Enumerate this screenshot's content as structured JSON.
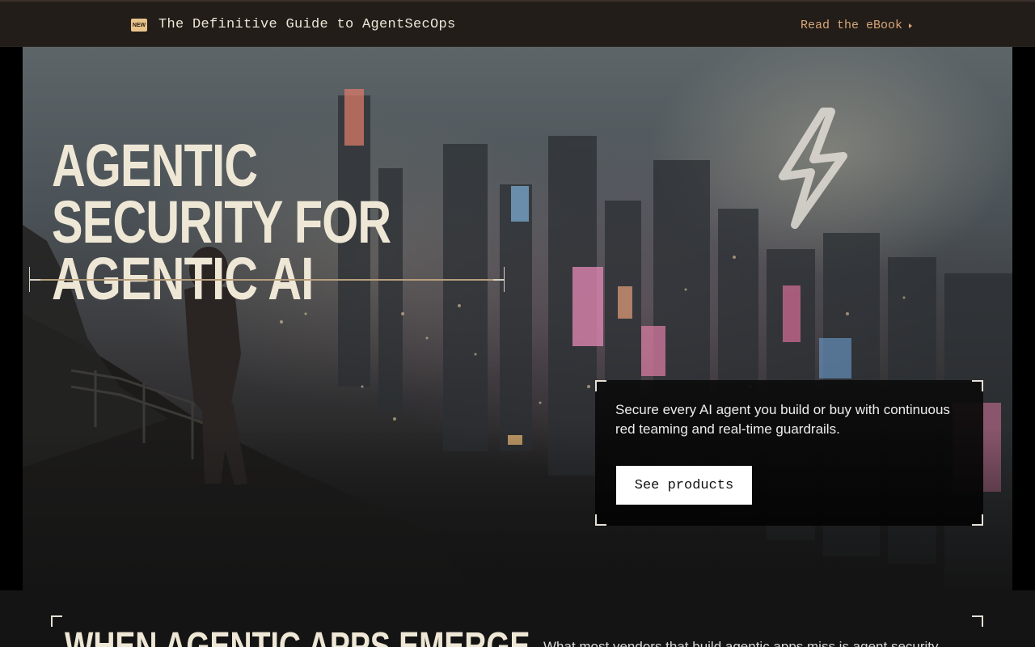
{
  "announcement": {
    "badge": "NEW",
    "title": "The Definitive Guide to AgentSecOps",
    "link_label": "Read the eBook"
  },
  "hero": {
    "title": "Agentic Security for Agentic AI",
    "description": "Secure every AI agent you build or buy with continuous red teaming and real-time guardrails.",
    "cta_label": "See products"
  },
  "next_section": {
    "title": "When agentic apps emerge",
    "text": "What most vendors that build agentic apps miss is agent security…"
  },
  "colors": {
    "accent": "#d8a679",
    "title_text": "#efe7d6",
    "bar_background": "#221d18"
  }
}
